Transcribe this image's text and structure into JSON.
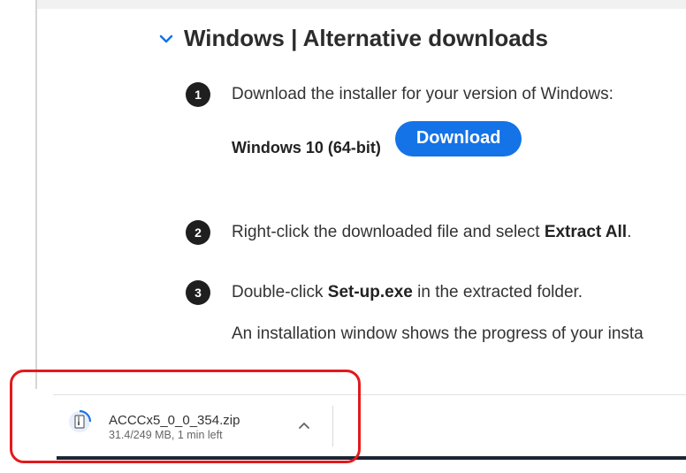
{
  "section": {
    "title": "Windows | Alternative downloads",
    "chevron_icon": "chevron-down-icon",
    "accent_color": "#1473e6"
  },
  "steps": [
    {
      "number": "1",
      "text": "Download the installer for your version of Windows:"
    },
    {
      "number": "2",
      "text_before": "Right-click the downloaded file and select ",
      "bold": "Extract All",
      "text_after": "."
    },
    {
      "number": "3",
      "text_before": "Double-click ",
      "bold": "Set-up.exe",
      "text_after": " in the extracted folder."
    }
  ],
  "platform": {
    "label": "Windows 10 (64-bit)",
    "button_label": "Download"
  },
  "note": "An installation window shows the progress of your insta",
  "download_shelf": {
    "file_name": "ACCCx5_0_0_354.zip",
    "status": "31.4/249 MB, 1 min left",
    "file_icon": "zip-file-icon",
    "expand_icon": "chevron-up-icon",
    "highlight_color": "#e3191c"
  }
}
